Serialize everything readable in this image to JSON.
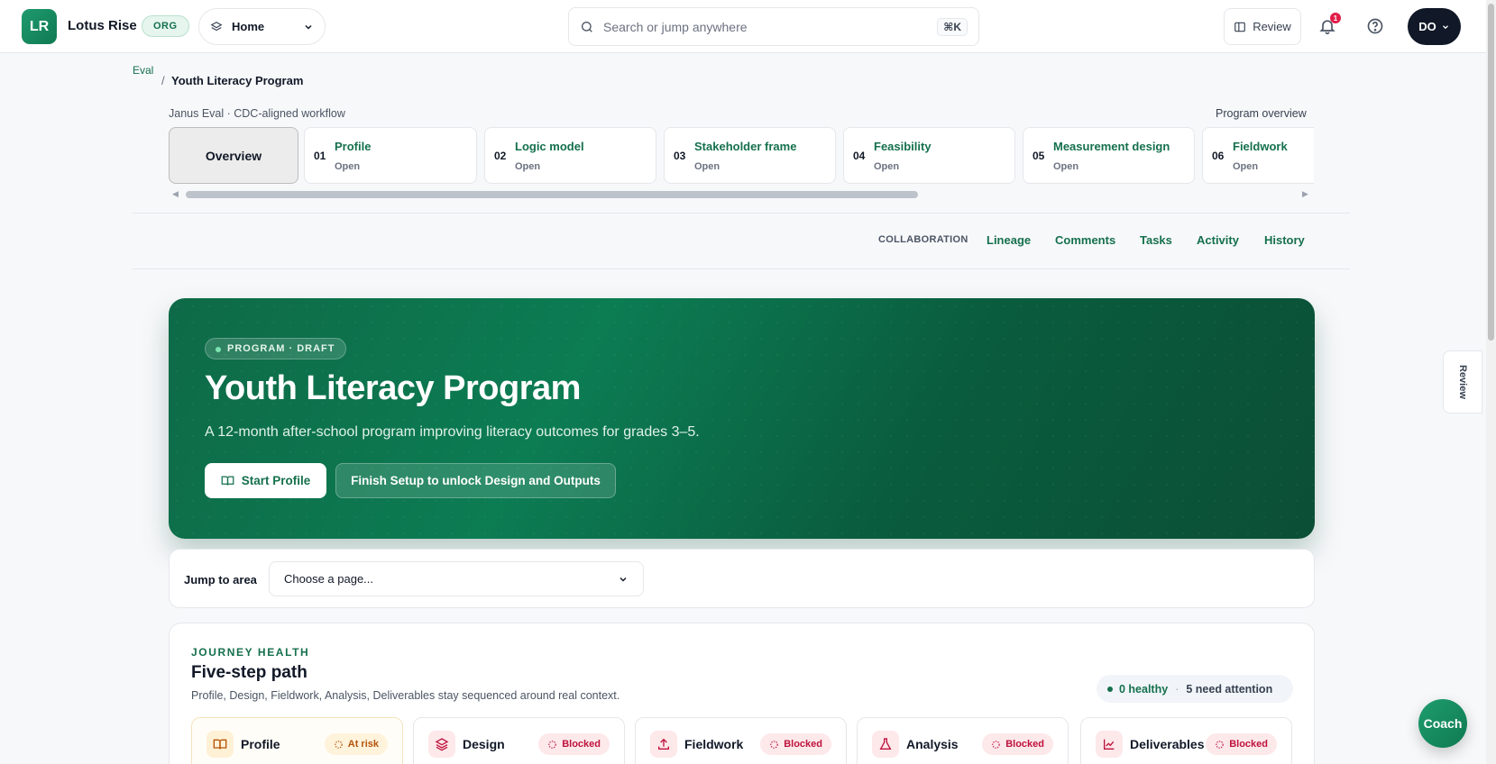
{
  "app": {
    "logo_text": "LR",
    "org_name": "Lotus Rise",
    "org_badge": "ORG",
    "workspace_select": "Home",
    "search_placeholder": "Search or jump anywhere",
    "search_shortcut": "⌘K",
    "review_label": "Review",
    "notification_count": "1",
    "avatar_initials": "DO"
  },
  "breadcrumb": {
    "parent": "Eval",
    "separator": "/",
    "current": "Youth Literacy Program"
  },
  "workflow": {
    "label": "Janus Eval · CDC-aligned workflow",
    "overview_link": "Program overview",
    "overview_tab": "Overview",
    "steps": [
      {
        "num": "01",
        "name": "Profile",
        "status": "Open"
      },
      {
        "num": "02",
        "name": "Logic model",
        "status": "Open"
      },
      {
        "num": "03",
        "name": "Stakeholder frame",
        "status": "Open"
      },
      {
        "num": "04",
        "name": "Feasibility",
        "status": "Open"
      },
      {
        "num": "05",
        "name": "Measurement design",
        "status": "Open"
      },
      {
        "num": "06",
        "name": "Fieldwork",
        "status": "Open"
      }
    ]
  },
  "collaboration": {
    "label": "COLLABORATION",
    "links": [
      "Lineage",
      "Comments",
      "Tasks",
      "Activity",
      "History"
    ]
  },
  "hero": {
    "badge": "PROGRAM · DRAFT",
    "title": "Youth Literacy Program",
    "description": "A 12-month after-school program improving literacy outcomes for grades 3–5.",
    "primary_button": "Start Profile",
    "secondary_button": "Finish Setup to unlock Design and Outputs"
  },
  "jump": {
    "label": "Jump to area",
    "select_value": "Choose a page..."
  },
  "journey": {
    "kicker": "JOURNEY HEALTH",
    "title": "Five-step path",
    "subtitle": "Profile, Design, Fieldwork, Analysis, Deliverables stay sequenced around real context.",
    "healthy": "0 healthy",
    "sep": "·",
    "attention": "5 need attention",
    "stages": [
      {
        "name": "Profile",
        "status": "At risk",
        "icon": "book-icon"
      },
      {
        "name": "Design",
        "status": "Blocked",
        "icon": "layers-icon"
      },
      {
        "name": "Fieldwork",
        "status": "Blocked",
        "icon": "upload-icon"
      },
      {
        "name": "Analysis",
        "status": "Blocked",
        "icon": "flask-icon"
      },
      {
        "name": "Deliverables",
        "status": "Blocked",
        "icon": "chart-line-icon"
      }
    ]
  },
  "side": {
    "review_tab": "Review",
    "coach_button": "Coach"
  },
  "colors": {
    "brand": "#0f7a52",
    "accent_text": "#15704d",
    "risk": "#b45309",
    "blocked": "#be123c"
  }
}
